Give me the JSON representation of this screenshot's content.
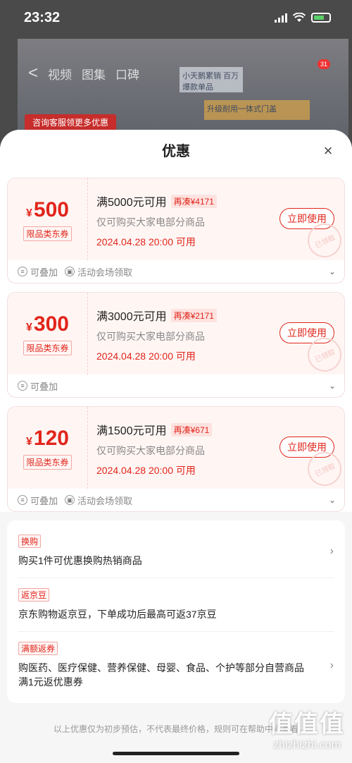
{
  "status": {
    "time": "23:32"
  },
  "background": {
    "nav_back": "<",
    "nav_tabs": [
      "视频",
      "图集",
      "口碑"
    ],
    "ad_1": "小天鹅累销 百万爆款单品",
    "ad_2": "升级耐用一体式门盖",
    "ad_red": "咨询客服领更多优惠",
    "badge": "31"
  },
  "sheet": {
    "title": "优惠",
    "close": "×"
  },
  "coupons": [
    {
      "yen": "¥",
      "amount": "500",
      "tag": "限品类东券",
      "condition": "满5000元可用",
      "again": "再凑¥4171",
      "desc": "仅可购买大家电部分商品",
      "date": "2024.04.28 20:00 可用",
      "button": "立即使用",
      "stamp": "已领取",
      "foot_1": "可叠加",
      "foot_2": "活动会场领取"
    },
    {
      "yen": "¥",
      "amount": "300",
      "tag": "限品类东券",
      "condition": "满3000元可用",
      "again": "再凑¥2171",
      "desc": "仅可购买大家电部分商品",
      "date": "2024.04.28 20:00 可用",
      "button": "立即使用",
      "stamp": "已领取",
      "foot_1": "可叠加",
      "foot_2": ""
    },
    {
      "yen": "¥",
      "amount": "120",
      "tag": "限品类东券",
      "condition": "满1500元可用",
      "again": "再凑¥671",
      "desc": "仅可购买大家电部分商品",
      "date": "2024.04.28 20:00 可用",
      "button": "立即使用",
      "stamp": "已领取",
      "foot_1": "可叠加",
      "foot_2": "活动会场领取"
    }
  ],
  "promos": [
    {
      "tag": "换购",
      "text": "购买1件可优惠换购热销商品",
      "arrow": "›"
    },
    {
      "tag": "返京豆",
      "text": "京东购物返京豆，下单成功后最高可返37京豆",
      "arrow": ""
    },
    {
      "tag": "满额返券",
      "text": "购医药、医疗保健、营养保健、母婴、食品、个护等部分自营商品满1元返优惠券",
      "arrow": "›"
    }
  ],
  "disclaimer": "以上优惠仅为初步预估，不代表最终价格，规则可在帮助中心查看",
  "watermark": {
    "big": "值值值",
    "small": "zhizhizhi.com"
  },
  "colors": {
    "accent": "#e1251b",
    "sheet_bg": "#f6f6f6"
  }
}
